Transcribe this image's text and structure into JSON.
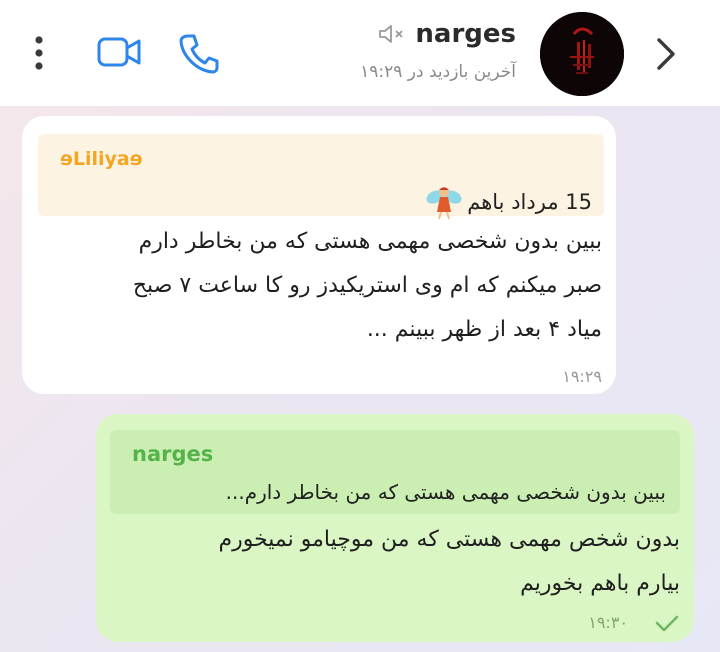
{
  "header": {
    "contact_name": "narges",
    "last_seen": "آخرین بازدید در ۱۹:۲۹",
    "icons": [
      "more-vertical-icon",
      "video-call-icon",
      "phone-icon",
      "mute-icon",
      "chevron-right-icon"
    ]
  },
  "messages": [
    {
      "direction": "incoming",
      "reply_to_name": "ɘLiliyaɘ",
      "reply_to_text": "15 مرداد باهم",
      "text_lines": [
        "ببین بدون شخصی مهمی هستی که من بخاطر دارم",
        "صبر میکنم که ام وی استریکیدز رو کا ساعت ۷ صبح",
        "میاد ۴ بعد از ظهر ببینم ..."
      ],
      "time": "۱۹:۲۹"
    },
    {
      "direction": "outgoing",
      "reply_to_name": "narges",
      "reply_to_text": "ببین بدون شخصی مهمی هستی که من بخاطر دارم...",
      "text_lines": [
        "بدون شخص مهمی هستی که من موچیامو نمیخورم",
        "بیارم باهم بخوریم"
      ],
      "time": "۱۹:۳۰",
      "status": "sent"
    }
  ],
  "colors": {
    "accent_blue": "#2f86ea",
    "incoming_bubble": "#ffffff",
    "outgoing_bubble": "#dbf6c5",
    "reply_name_incoming": "#f2a623",
    "reply_name_outgoing": "#55b34a"
  }
}
